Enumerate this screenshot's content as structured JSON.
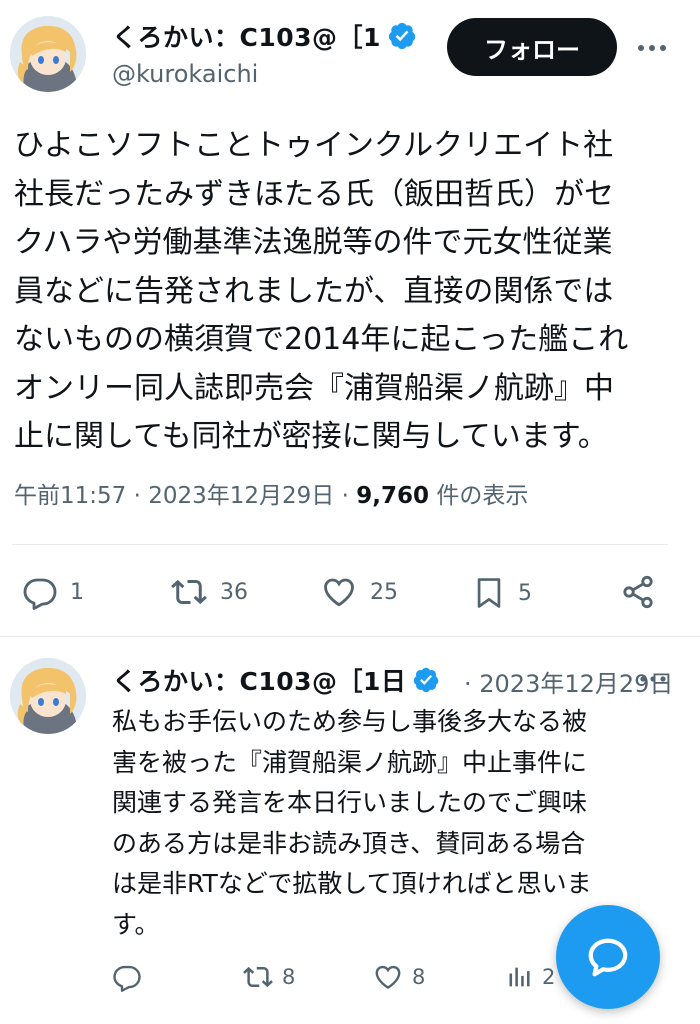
{
  "tweet": {
    "author": {
      "display_name": "くろかい：C103@［1",
      "handle": "@kurokaichi"
    },
    "follow_label": "フォロー",
    "text": "ひよこソフトことトゥインクルクリエイト社\n社長だったみずきほたる氏（飯田哲氏）がセ\nクハラや労働基準法逸脱等の件で元女性従業\n員などに告発されましたが、直接の関係では\nないものの横須賀で2014年に起こった艦これ\nオンリー同人誌即売会『浦賀船渠ノ航跡』中\n止に関しても同社が密接に関与しています。",
    "time": "午前11:57",
    "separator": "·",
    "date": "2023年12月29日",
    "views_count": "9,760",
    "views_label": "件の表示",
    "actions": {
      "replies": "1",
      "retweets": "36",
      "likes": "25",
      "bookmarks": "5"
    }
  },
  "reply": {
    "author": {
      "display_name": "くろかい：C103@［1日"
    },
    "date": "· 2023年12月29日",
    "text": "私もお手伝いのため参与し事後多大なる被\n害を被った『浦賀船渠ノ航跡』中止事件に\n関連する発言を本日行いましたのでご興味\nのある方は是非お読み頂き、賛同ある場合\nは是非RTなどで拡散して頂ければと思いま\nす。",
    "actions": {
      "retweets": "8",
      "likes": "8",
      "views": "2"
    }
  },
  "colors": {
    "accent": "#1d9bf0",
    "text": "#0f1419",
    "secondary": "#536471",
    "divider": "#e7e9ea"
  },
  "icons": [
    "verified-badge-icon",
    "more-icon",
    "reply-icon",
    "retweet-icon",
    "like-icon",
    "bookmark-icon",
    "share-icon",
    "views-icon",
    "compose-icon"
  ]
}
